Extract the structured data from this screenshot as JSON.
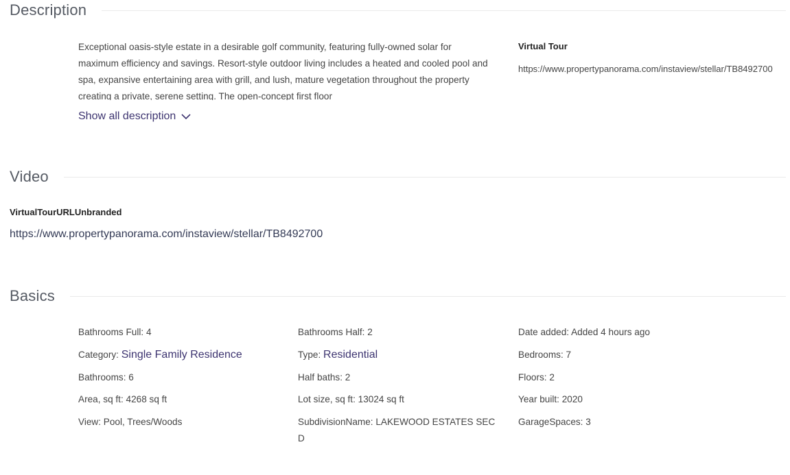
{
  "sections": {
    "description_title": "Description",
    "video_title": "Video",
    "basics_title": "Basics"
  },
  "description": {
    "text": "Exceptional oasis-style estate in a desirable golf community, featuring fully-owned solar for maximum efficiency and savings. Resort-style outdoor living includes a heated and cooled pool and spa, expansive entertaining area with grill, and lush, mature vegetation throughout the property creating a private, serene setting. The open-concept first floor",
    "show_all_label": "Show all description",
    "virtual_tour_label": "Virtual Tour",
    "virtual_tour_url": "https://www.propertypanorama.com/instaview/stellar/TB8492700"
  },
  "video": {
    "label": "VirtualTourURLUnbranded",
    "url": "https://www.propertypanorama.com/instaview/stellar/TB8492700"
  },
  "basics": {
    "bathrooms_full": "Bathrooms Full: 4",
    "bathrooms_half": "Bathrooms Half: 2",
    "date_added": "Date added: Added 4 hours ago",
    "category_label": "Category: ",
    "category_value": "Single Family Residence",
    "type_label": "Type: ",
    "type_value": "Residential",
    "bedrooms": "Bedrooms: 7",
    "bathrooms": "Bathrooms: 6",
    "half_baths": "Half baths: 2",
    "floors": "Floors: 2",
    "area": "Area, sq ft: 4268 sq ft",
    "lot_size": "Lot size, sq ft: 13024 sq ft",
    "year_built": "Year built: 2020",
    "view": "View: Pool, Trees/Woods",
    "subdivision": "SubdivisionName: LAKEWOOD ESTATES SEC D",
    "garage_spaces": "GarageSpaces: 3"
  },
  "colors": {
    "accent": "#3d3470",
    "rule": "#eaeaea",
    "heading": "#555a63"
  },
  "icons": {
    "show_all": "chevron-down-icon"
  }
}
